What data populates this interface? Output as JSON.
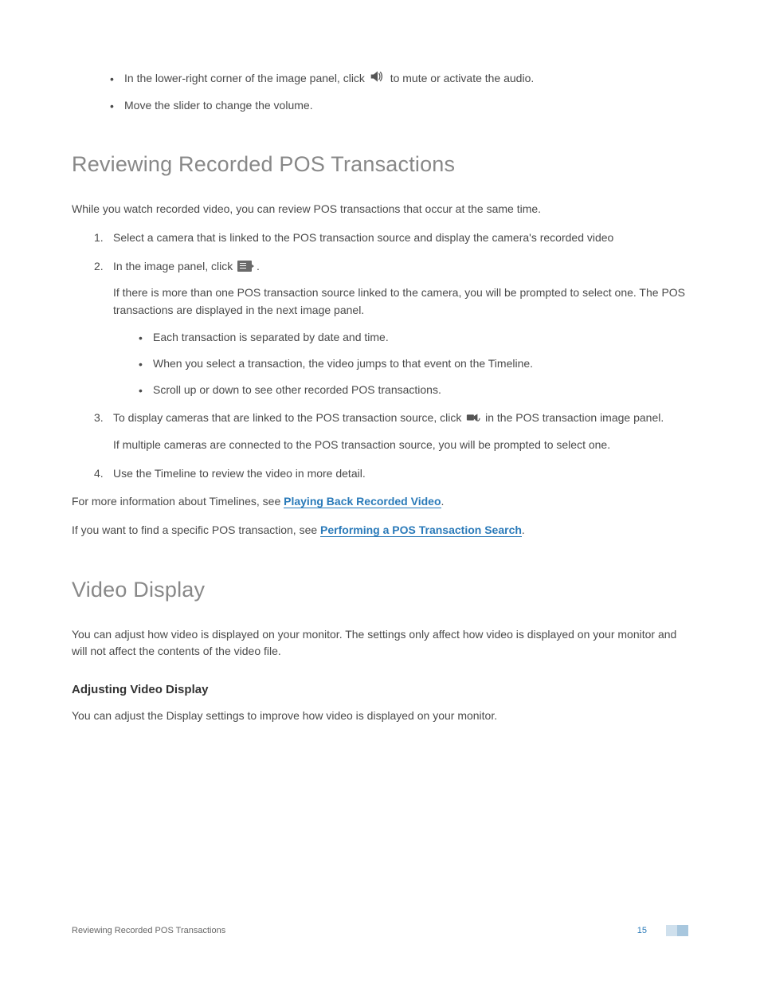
{
  "intro_bullets": [
    {
      "before": "In the lower-right corner of the image panel, click ",
      "after": " to mute or activate the audio."
    },
    {
      "text": "Move the slider to change the volume."
    }
  ],
  "section1": {
    "heading": "Reviewing Recorded POS Transactions",
    "intro": "While you watch recorded video, you can review POS transactions that occur at the same time.",
    "steps": {
      "s1": "Select a camera that is linked to the POS transaction source and display the camera's recorded video",
      "s2_before": "In the image panel, click ",
      "s2_after": ".",
      "s2_para": "If there is more than one POS transaction source linked to the camera, you will be prompted to select one. The POS transactions are displayed in the next image panel.",
      "s2_bullets": [
        "Each transaction is separated by date and time.",
        "When you select a transaction, the video jumps to that event on the Timeline.",
        "Scroll up or down to see other recorded POS transactions."
      ],
      "s3_before": "To display cameras that are linked to the POS transaction source, click ",
      "s3_after": " in the POS transaction image panel.",
      "s3_para": "If multiple cameras are connected to the POS transaction source, you will be prompted to select one.",
      "s4": "Use the Timeline to review the video in more detail."
    },
    "more1_before": "For more information about Timelines, see ",
    "more1_link": "Playing Back Recorded Video",
    "more1_after": ".",
    "more2_before": "If you want to find a specific POS transaction, see ",
    "more2_link": "Performing a POS Transaction Search",
    "more2_after": "."
  },
  "section2": {
    "heading": "Video Display",
    "intro": "You can adjust how video is displayed on your monitor. The settings only affect how video is displayed on your monitor and will not affect the contents of the video file.",
    "sub_heading": "Adjusting Video Display",
    "sub_text": "You can adjust the Display settings to improve how video is displayed on your monitor."
  },
  "footer": {
    "title": "Reviewing Recorded POS Transactions",
    "page": "15"
  }
}
